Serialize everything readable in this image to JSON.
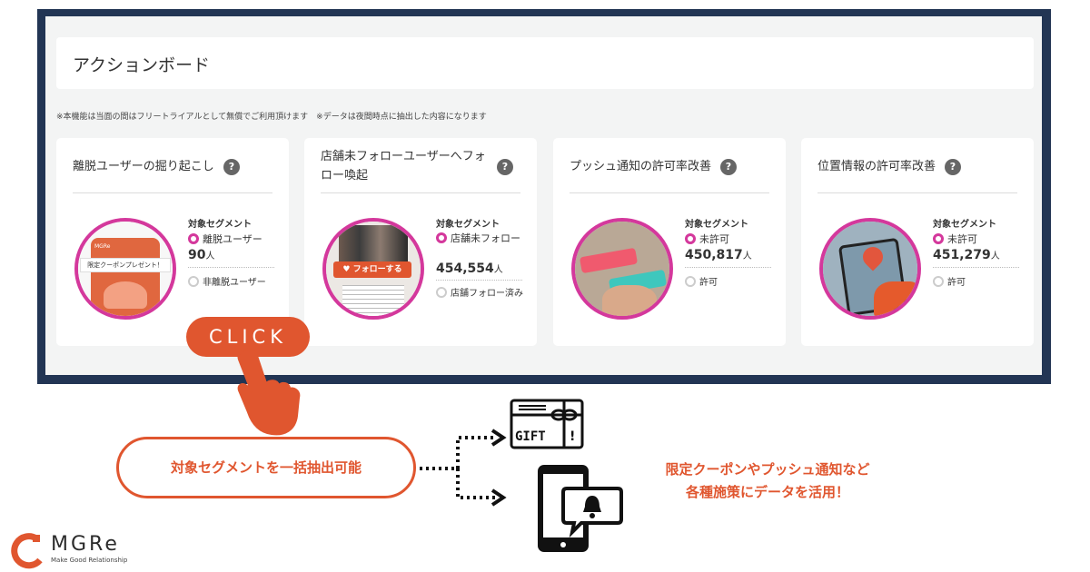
{
  "header": {
    "title": "アクションボード"
  },
  "notice": "※本機能は当面の間はフリートライアルとして無償でご利用頂けます　※データは夜間時点に抽出した内容になります",
  "cards": [
    {
      "title": "離脱ユーザーの掘り起こし",
      "segment_label": "対象セグメント",
      "selected": "離脱ユーザー",
      "count": "90",
      "unit": "人",
      "other": "非離脱ユーザー",
      "illus_brand": "MGRe",
      "illus_banner": "限定クーポンプレゼント！"
    },
    {
      "title": "店舗未フォローユーザーへフォロー喚起",
      "segment_label": "対象セグメント",
      "selected": "店舗未フォロー",
      "count": "454,554",
      "unit": "人",
      "other": "店舗フォロー済み",
      "illus_button": "フォローする"
    },
    {
      "title": "プッシュ通知の許可率改善",
      "segment_label": "対象セグメント",
      "selected": "未許可",
      "count": "450,817",
      "unit": "人",
      "other": "許可"
    },
    {
      "title": "位置情報の許可率改善",
      "segment_label": "対象セグメント",
      "selected": "未許可",
      "count": "451,279",
      "unit": "人",
      "other": "許可"
    }
  ],
  "help_glyph": "?",
  "click_label": "CLICK",
  "extract_label": "対象セグメントを一括抽出可能",
  "gift_label": "GIFT",
  "promo_lines": [
    "限定クーポンやプッシュ通知など",
    "各種施策にデータを活用！"
  ],
  "logo": {
    "name": "MGRe",
    "tagline": "Make Good Relationship"
  },
  "colors": {
    "accent": "#e0562f",
    "segment": "#d4389c",
    "frame": "#223554"
  }
}
